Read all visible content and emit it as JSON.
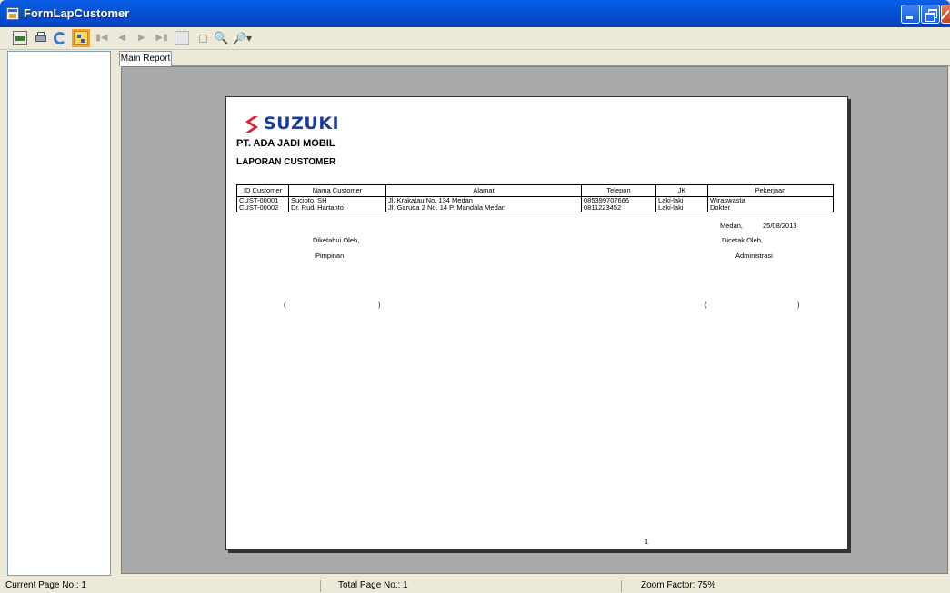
{
  "window": {
    "title": "FormLapCustomer"
  },
  "tab": {
    "label": "Main Report"
  },
  "report": {
    "brand": "SUZUKI",
    "company": "PT. ADA JADI MOBIL",
    "title": "LAPORAN CUSTOMER",
    "columns": [
      "ID Customer",
      "Nama Customer",
      "Alamat",
      "Telepon",
      "JK",
      "Pekerjaan"
    ],
    "rows": [
      [
        "CUST-00001",
        "Sucipto, SH",
        "Jl. Krakatau No. 134 Medan",
        "085399707666",
        "Laki-laki",
        "Wiraswasta"
      ],
      [
        "CUST-00002",
        "Dr. Rudi Hartanto",
        "Jl. Garuda 2 No. 14 P. Mandala Medan",
        "0811223452",
        "Laki-laki",
        "Dokter"
      ]
    ],
    "place": "Medan,",
    "date": "25/08/2013",
    "known_by": "Diketahui Oleh,",
    "known_role": "Pimpinan",
    "printed_by": "Dicetak Oleh,",
    "printed_role": "Administrasi",
    "paren_open": "(",
    "paren_close": ")",
    "page_number": "1"
  },
  "status": {
    "current_page": "Current Page No.: 1",
    "total_page": "Total Page No.: 1",
    "zoom": "Zoom Factor: 75%"
  },
  "colors": {
    "title_bar": "#0553d6",
    "viewer_bg": "#a9a9a9",
    "brand": "#1b3c9e",
    "logo_red": "#d9232e"
  }
}
